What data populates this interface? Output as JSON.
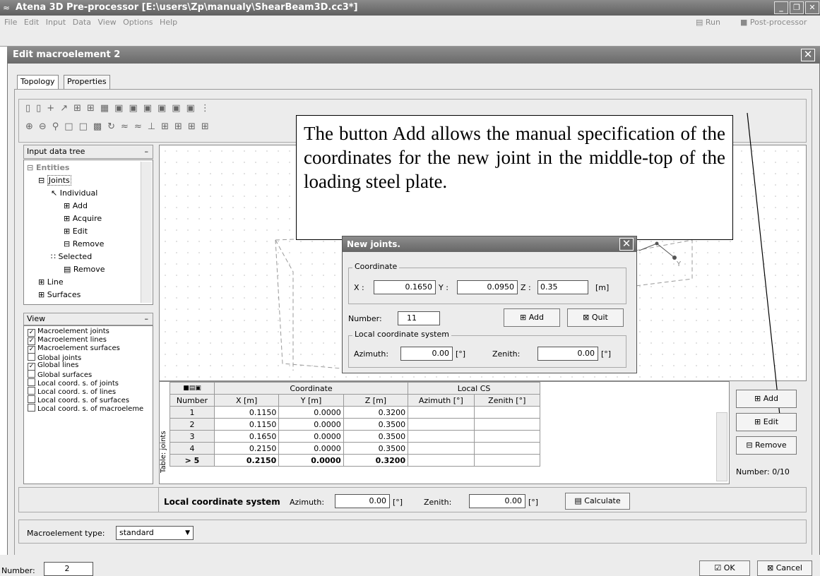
{
  "app": {
    "title": "Atena 3D Pre-processor [E:\\users\\Zp\\manualy\\ShearBeam3D.cc3*]",
    "menu": [
      "File",
      "Edit",
      "Input",
      "Data",
      "View",
      "Options",
      "Help"
    ],
    "run_label": "Run",
    "postprocessor_label": "Post-processor"
  },
  "dialog": {
    "title": "Edit macroelement 2",
    "tabs": [
      "Topology",
      "Properties"
    ]
  },
  "input_tree": {
    "header": "Input data tree",
    "items": [
      "Entities",
      "Joints",
      "Individual",
      "Add",
      "Acquire",
      "Edit",
      "Remove",
      "Selected",
      "Remove",
      "Line",
      "Surfaces"
    ]
  },
  "view_panel": {
    "header": "View",
    "items": [
      {
        "label": "Macroelement joints",
        "checked": true
      },
      {
        "label": "Macroelement lines",
        "checked": true
      },
      {
        "label": "Macroelement surfaces",
        "checked": true
      },
      {
        "label": "Global joints",
        "checked": false
      },
      {
        "label": "Global lines",
        "checked": true
      },
      {
        "label": "Global surfaces",
        "checked": false
      },
      {
        "label": "Local coord. s. of joints",
        "checked": false
      },
      {
        "label": "Local coord. s. of lines",
        "checked": false
      },
      {
        "label": "Local coord. s. of surfaces",
        "checked": false
      },
      {
        "label": "Local coord. s. of macroeleme",
        "checked": false
      }
    ]
  },
  "callout": {
    "text": "The button Add allows the manual specification of the coordinates for the new joint in the middle-top of the loading steel plate."
  },
  "new_joints": {
    "title": "New joints.",
    "coordinate_group": "Coordinate",
    "x_label": "X :",
    "x_value": "0.1650",
    "y_label": "Y :",
    "y_value": "0.0950",
    "z_label": "Z :",
    "z_value": "0.35",
    "unit": "[m]",
    "number_label": "Number:",
    "number_value": "11",
    "add_label": "Add",
    "quit_label": "Quit",
    "lcs_group": "Local coordinate system",
    "azimuth_label": "Azimuth:",
    "azimuth_value": "0.00",
    "zenith_label": "Zenith:",
    "zenith_value": "0.00",
    "deg_unit": "[°]"
  },
  "joints_table": {
    "side_label": "Table: joints",
    "group_headers": {
      "coordinate": "Coordinate",
      "local_cs": "Local CS"
    },
    "columns": [
      "Number",
      "X [m]",
      "Y [m]",
      "Z [m]",
      "Azimuth [°]",
      "Zenith [°]"
    ],
    "rows": [
      {
        "n": "1",
        "x": "0.1150",
        "y": "0.0000",
        "z": "0.3200"
      },
      {
        "n": "2",
        "x": "0.1150",
        "y": "0.0000",
        "z": "0.3500"
      },
      {
        "n": "3",
        "x": "0.1650",
        "y": "0.0000",
        "z": "0.3500"
      },
      {
        "n": "4",
        "x": "0.2150",
        "y": "0.0000",
        "z": "0.3500"
      },
      {
        "n": "> 5",
        "x": "0.2150",
        "y": "0.0000",
        "z": "0.3200"
      }
    ]
  },
  "side_buttons": {
    "add": "Add",
    "edit": "Edit",
    "remove": "Remove",
    "number": "Number: 0/10"
  },
  "lcs_bar": {
    "label": "Local coordinate system",
    "azimuth_label": "Azimuth:",
    "azimuth_value": "0.00",
    "zenith_label": "Zenith:",
    "zenith_value": "0.00",
    "deg_unit": "[°]",
    "calculate": "Calculate"
  },
  "macro_type": {
    "label": "Macroelement type:",
    "value": "standard"
  },
  "footer": {
    "number_label": "Number:",
    "number_value": "2",
    "ok": "OK",
    "cancel": "Cancel"
  }
}
